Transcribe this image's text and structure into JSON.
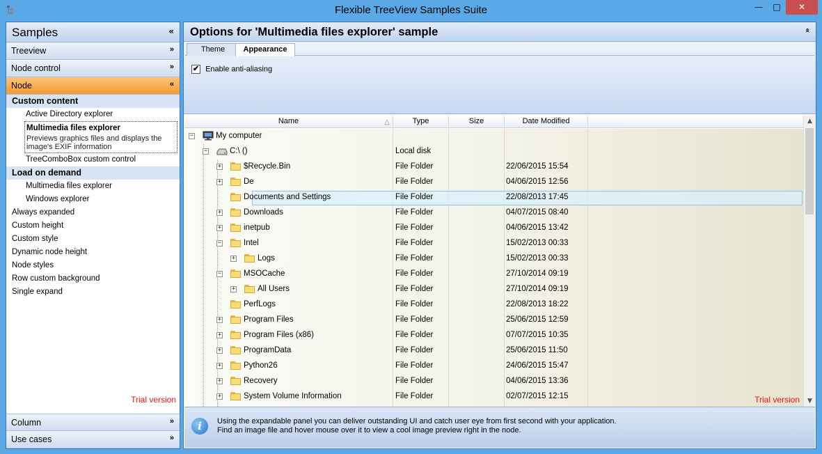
{
  "window": {
    "title": "Flexible TreeView Samples Suite",
    "min_label": "—",
    "max_label": "□",
    "close_label": "✕"
  },
  "sidebar": {
    "title": "Samples",
    "collapse_glyph": "«",
    "groups_top": [
      {
        "label": "Treeview",
        "chevron": "»"
      },
      {
        "label": "Node control",
        "chevron": "»"
      }
    ],
    "active_group": {
      "label": "Node",
      "chevron": "«"
    },
    "custom_content": {
      "header": "Custom content",
      "item1": "Active Directory explorer",
      "selected_title": "Multimedia files explorer",
      "selected_desc": "Previews graphics files and displays the image's EXIF information",
      "item3": "TreeComboBox custom control"
    },
    "load_on_demand": {
      "header": "Load on demand",
      "item1": "Multimedia files explorer",
      "item2": "Windows explorer"
    },
    "other_items": [
      "Always expanded",
      "Custom height",
      "Custom style",
      "Dynamic node height",
      "Node styles",
      "Row custom background",
      "Single expand"
    ],
    "trial": "Trial version",
    "groups_bottom": [
      {
        "label": "Column",
        "chevron": "»"
      },
      {
        "label": "Use cases",
        "chevron": "»"
      }
    ]
  },
  "main": {
    "title": "Options for 'Multimedia files explorer' sample",
    "collapse_glyph": "«",
    "tabs": [
      "Theme",
      "Appearance"
    ],
    "active_tab": "Appearance",
    "anti_aliasing": {
      "label": "Enable anti-aliasing",
      "checked": true,
      "mark": "✔"
    },
    "columns": [
      "Name",
      "Type",
      "Size",
      "Date Modified"
    ],
    "sort_glyph": "△",
    "rows": [
      {
        "name": "My computer",
        "type": "",
        "date": ""
      },
      {
        "name": "C:\\ ()",
        "type": "Local disk",
        "date": ""
      },
      {
        "name": "$Recycle.Bin",
        "type": "File Folder",
        "date": "22/06/2015 15:54"
      },
      {
        "name": "De",
        "type": "File Folder",
        "date": "04/06/2015 12:56"
      },
      {
        "name": "Documents and Settings",
        "type": "File Folder",
        "date": "22/08/2013 17:45"
      },
      {
        "name": "Downloads",
        "type": "File Folder",
        "date": "04/07/2015 08:40"
      },
      {
        "name": "inetpub",
        "type": "File Folder",
        "date": "04/06/2015 13:42"
      },
      {
        "name": "Intel",
        "type": "File Folder",
        "date": "15/02/2013 00:33"
      },
      {
        "name": "Logs",
        "type": "File Folder",
        "date": "15/02/2013 00:33"
      },
      {
        "name": "MSOCache",
        "type": "File Folder",
        "date": "27/10/2014 09:19"
      },
      {
        "name": "All Users",
        "type": "File Folder",
        "date": "27/10/2014 09:19"
      },
      {
        "name": "PerfLogs",
        "type": "File Folder",
        "date": "22/08/2013 18:22"
      },
      {
        "name": "Program Files",
        "type": "File Folder",
        "date": "25/06/2015 12:59"
      },
      {
        "name": "Program Files (x86)",
        "type": "File Folder",
        "date": "07/07/2015 10:35"
      },
      {
        "name": "ProgramData",
        "type": "File Folder",
        "date": "25/06/2015 11:50"
      },
      {
        "name": "Python26",
        "type": "File Folder",
        "date": "24/06/2015 15:47"
      },
      {
        "name": "Recovery",
        "type": "File Folder",
        "date": "04/06/2015 13:36"
      },
      {
        "name": "System Volume Information",
        "type": "File Folder",
        "date": "02/07/2015 12:15"
      }
    ],
    "trial": "Trial version",
    "scroll_up": "▲",
    "scroll_down": "▼",
    "info_icon": "i",
    "info_line1": "Using the expandable panel you can deliver outstanding UI and catch user eye from first second with your application.",
    "info_line2": "Find an image file and hover mouse over it to view a cool image preview right in the node."
  }
}
